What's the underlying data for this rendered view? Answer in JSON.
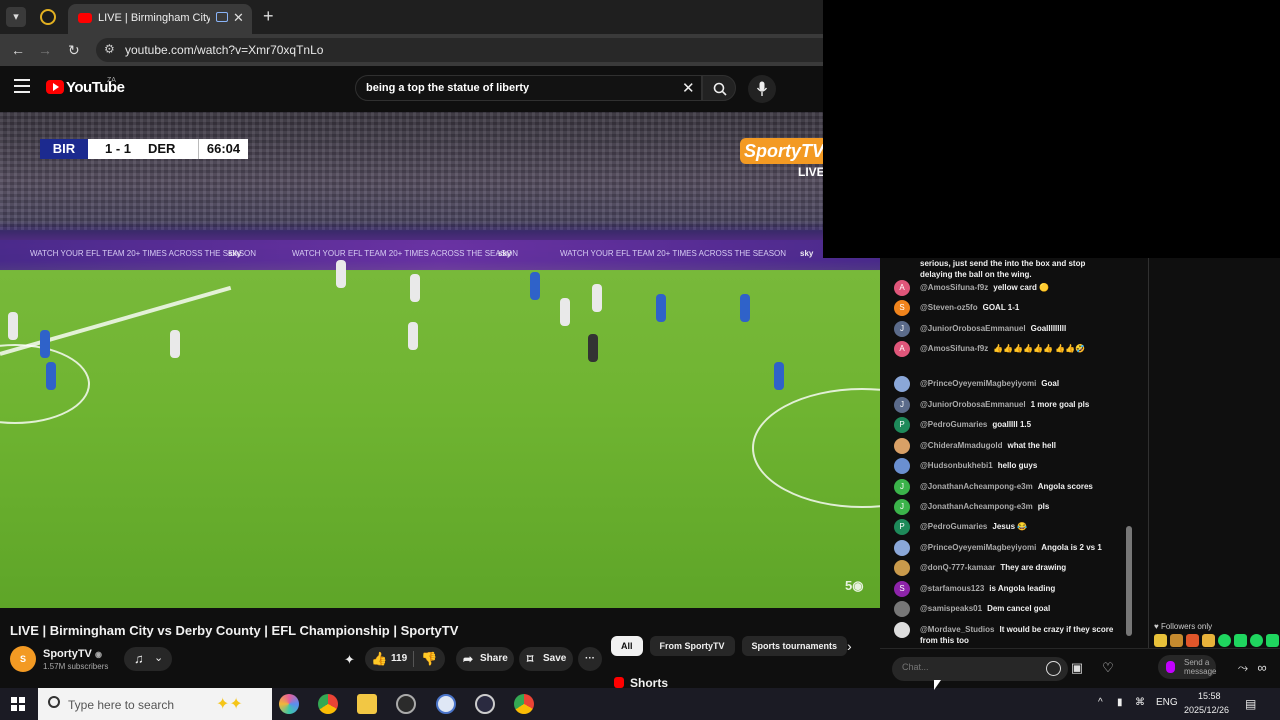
{
  "browser": {
    "tab_title": "LIVE | Birmingham City vs D",
    "url": "youtube.com/watch?v=Xmr70xqTnLo"
  },
  "masthead": {
    "logo_text": "YouTube",
    "region": "ZA",
    "search_value": "being a top the statue of liberty"
  },
  "scoreboard": {
    "home": "BIR",
    "score": "1 - 1",
    "away": "DER",
    "clock": "66:04"
  },
  "broadcast": {
    "logo": "SportyTV",
    "live": "LIVE",
    "board_text": "WATCH YOUR EFL TEAM 20+ TIMES ACROSS THE SEASON",
    "board_brand": "sky"
  },
  "video": {
    "title": "LIVE | Birmingham City vs Derby County | EFL Championship | SportyTV",
    "channel": "SportyTV",
    "channel_avatar": "S",
    "subscribers": "1.57M subscribers",
    "likes": "119",
    "share_label": "Share",
    "save_label": "Save",
    "more_label": "···"
  },
  "chips": [
    "All",
    "From SportyTV",
    "Sports tournaments"
  ],
  "shorts_label": "Shorts",
  "chat": {
    "first_line": "serious, just send the into the box and stop delaying the ball on the wing.",
    "messages": [
      {
        "initial": "A",
        "color": "#e0567a",
        "author": "@AmosSifuna-f9z",
        "text": "yellow card 🟡"
      },
      {
        "initial": "S",
        "color": "#f0841c",
        "author": "@Steven-oz5fo",
        "text": "GOAL 1-1"
      },
      {
        "initial": "J",
        "color": "#5b6b8a",
        "author": "@JuniorOrobosaEmmanuel",
        "text": "Goalllllllll"
      },
      {
        "initial": "A",
        "color": "#e0567a",
        "author": "@AmosSifuna-f9z",
        "text": "👍👍👍👍👍👍 👍👍🤣"
      },
      {
        "initial": "",
        "color": "#8aa7d8",
        "author": "@PrinceOyeyemiMagbeyiyomi",
        "text": "Goal"
      },
      {
        "initial": "J",
        "color": "#5b6b8a",
        "author": "@JuniorOrobosaEmmanuel",
        "text": "1 more goal pls"
      },
      {
        "initial": "P",
        "color": "#1e8a5a",
        "author": "@PedroGumaries",
        "text": "goalllll 1.5"
      },
      {
        "initial": "",
        "color": "#d9a066",
        "author": "@ChideraMmadugold",
        "text": "what the hell"
      },
      {
        "initial": "",
        "color": "#6a8fd0",
        "author": "@Hudsonbukhebi1",
        "text": "hello guys"
      },
      {
        "initial": "J",
        "color": "#3bb34a",
        "author": "@JonathanAcheampong-e3m",
        "text": "Angola scores"
      },
      {
        "initial": "J",
        "color": "#3bb34a",
        "author": "@JonathanAcheampong-e3m",
        "text": "pls"
      },
      {
        "initial": "P",
        "color": "#1e8a5a",
        "author": "@PedroGumaries",
        "text": "Jesus 😂"
      },
      {
        "initial": "",
        "color": "#8aa7d8",
        "author": "@PrinceOyeyemiMagbeyiyomi",
        "text": "Angola is 2 vs 1"
      },
      {
        "initial": "",
        "color": "#c99a4b",
        "author": "@donQ-777-kamaar",
        "text": "They are drawing"
      },
      {
        "initial": "S",
        "color": "#8e24aa",
        "author": "@starfamous123",
        "text": "is Angola leading"
      },
      {
        "initial": "",
        "color": "#777777",
        "author": "@samispeaks01",
        "text": "Dem cancel goal"
      },
      {
        "initial": "",
        "color": "#dddddd",
        "author": "@Mordave_Studios",
        "text": "It would be crazy if they score from this too"
      }
    ],
    "followers_only": "♥ Followers only",
    "input_placeholder": "Chat...",
    "send_label": "Send a message"
  },
  "taskbar": {
    "search_placeholder": "Type here to search",
    "lang": "ENG",
    "time": "15:58",
    "date": "2025/12/26"
  }
}
